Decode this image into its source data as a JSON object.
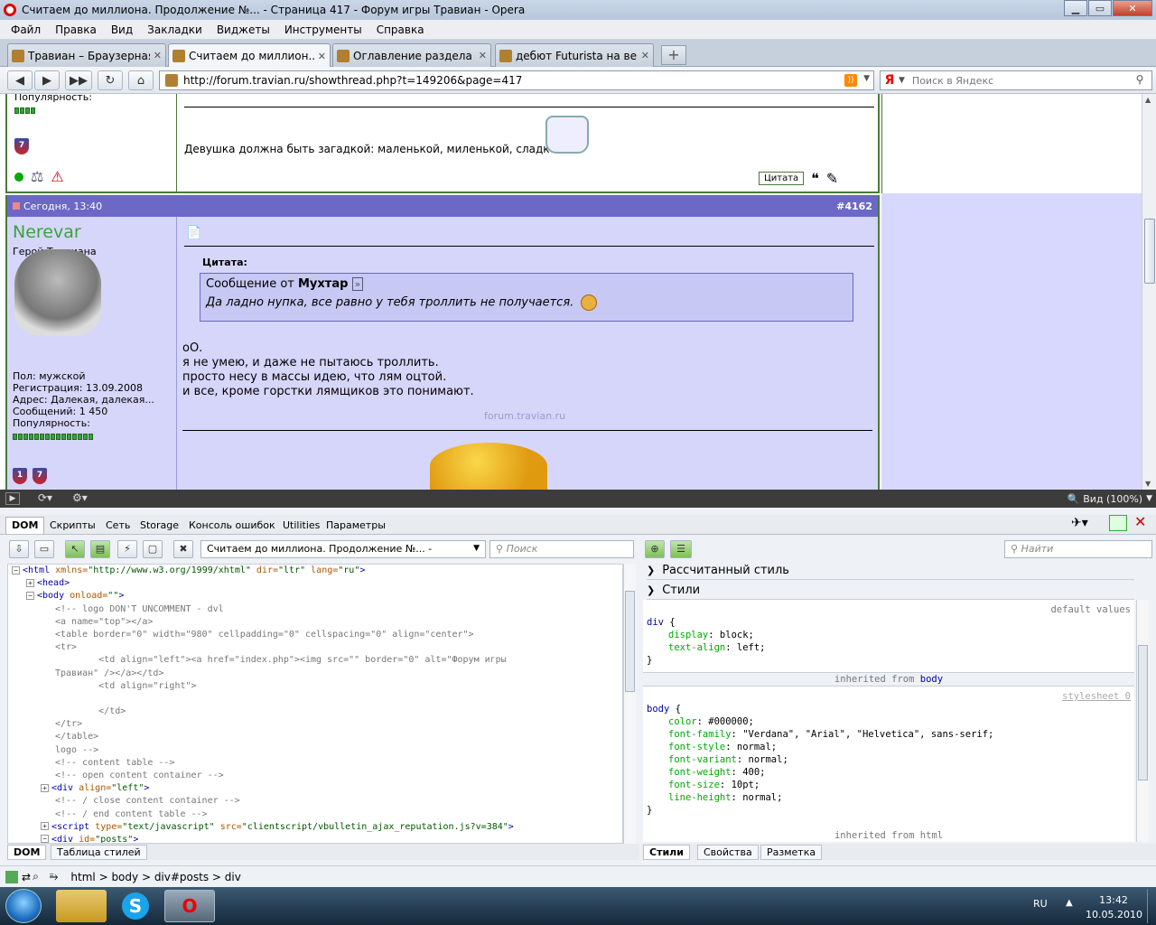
{
  "window": {
    "title": "Считаем до миллиона. Продолжение №... - Страница 417 - Форум игры Травиан - Opera",
    "btn_min": "▁",
    "btn_max": "▭",
    "btn_close": "✕"
  },
  "menu": [
    "Файл",
    "Правка",
    "Вид",
    "Закладки",
    "Виджеты",
    "Инструменты",
    "Справка"
  ],
  "tabs": [
    {
      "label": "Травиан – Браузерная...",
      "close": "✕"
    },
    {
      "label": "Считаем до миллион...",
      "close": "✕"
    },
    {
      "label": "Оглавление раздела Г...",
      "close": "✕"
    },
    {
      "label": "дебют Futurista на вер...",
      "close": "✕"
    }
  ],
  "new_tab": "+",
  "address": {
    "url": "http://forum.travian.ru/showthread.php?t=149206&page=417",
    "search_placeholder": "Поиск в Яндекс",
    "search_engine": "Я",
    "rss": "rss"
  },
  "nav": {
    "back": "◀",
    "forward": "▶",
    "fastforward": "▶▶",
    "reload": "↻",
    "home": "⌂"
  },
  "post_prev": {
    "popularity_label": "Популярность:",
    "shield": "7",
    "signature": "Девушка должна быть загадкой: маленькой, миленькой, сладкой.",
    "quote_btn": "Цитата"
  },
  "post": {
    "date": "Сегодня, 13:40",
    "number": "#4162",
    "username": "Nerevar",
    "usertitle": "Герой Травиана",
    "info": [
      "Пол: мужской",
      "Регистрация: 13.09.2008",
      "Адрес: Далекая, далекая...",
      "Сообщений: 1 450",
      "Популярность:"
    ],
    "shields": [
      "1",
      "7"
    ],
    "quote_label": "Цитата:",
    "quote_from_prefix": "Сообщение от",
    "quote_author": "Мухтар",
    "quote_text": "Да ладно нупка, все равно у тебя троллить не получается.",
    "body": [
      "оО.",
      "я не умею, и даже не пытаюсь троллить.",
      "просто несу в массы идею, что лям оцтой.",
      "и все, кроме горстки лямщиков это понимают."
    ],
    "watermark": "forum.travian.ru"
  },
  "statusbar": {
    "zoom": "Вид (100%)"
  },
  "devtools": {
    "tabs": [
      "DOM",
      "Скрипты",
      "Сеть",
      "Storage",
      "Консоль ошибок",
      "Utilities",
      "Параметры"
    ],
    "doc_select": "Считаем до миллиона. Продолжение №... -",
    "search_placeholder": "Поиск",
    "find_placeholder": "Найти",
    "bottom_tabs": [
      "DOM",
      "Таблица стилей"
    ],
    "right_bottom_tabs": [
      "Стили",
      "Свойства",
      "Разметка"
    ],
    "computed_label": "Рассчитанный стиль",
    "styles_label": "Стили",
    "default_values": "default values",
    "inherited_body": "inherited from",
    "inherited_body_el": "body",
    "stylesheet_link": "stylesheet 0",
    "inherited_html": "inherited from html",
    "breadcrumb": [
      "html",
      "body",
      "div#posts",
      "div"
    ]
  },
  "dom_lines": [
    {
      "indent": 0,
      "exp": "−",
      "html": "<span class='tag'>&lt;html</span> <span class='att'>xmlns=</span><span class='val'>\"http://www.w3.org/1999/xhtml\"</span> <span class='att'>dir=</span><span class='val'>\"ltr\"</span> <span class='att'>lang=</span><span class='val'>\"ru\"</span><span class='tag'>&gt;</span>"
    },
    {
      "indent": 1,
      "exp": "+",
      "html": "<span class='tag'>&lt;head&gt;</span>"
    },
    {
      "indent": 1,
      "exp": "−",
      "html": "<span class='tag'>&lt;body</span> <span class='att'>onload=</span><span class='val'>\"\"</span><span class='tag'>&gt;</span>"
    },
    {
      "indent": 2,
      "exp": "",
      "html": "<span class='cmt'>&lt;!-- logo DON'T UNCOMMENT - dvl</span>"
    },
    {
      "indent": 2,
      "exp": "",
      "html": "<span class='cmt'>&lt;a name=\"top\"&gt;&lt;/a&gt;</span>"
    },
    {
      "indent": 2,
      "exp": "",
      "html": "<span class='cmt'>&lt;table border=\"0\" width=\"980\" cellpadding=\"0\" cellspacing=\"0\" align=\"center\"&gt;</span>"
    },
    {
      "indent": 2,
      "exp": "",
      "html": "<span class='cmt'>&lt;tr&gt;</span>"
    },
    {
      "indent": 2,
      "exp": "",
      "html": "<span class='cmt'>&nbsp;&nbsp;&nbsp;&nbsp;&nbsp;&nbsp;&nbsp;&nbsp;&lt;td align=\"left\"&gt;&lt;a href=\"index.php\"&gt;&lt;img src=\"\" border=\"0\" alt=\"Форум игры</span>"
    },
    {
      "indent": 2,
      "exp": "",
      "html": "<span class='cmt'>Травиан\" /&gt;&lt;/a&gt;&lt;/td&gt;</span>"
    },
    {
      "indent": 2,
      "exp": "",
      "html": "<span class='cmt'>&nbsp;&nbsp;&nbsp;&nbsp;&nbsp;&nbsp;&nbsp;&nbsp;&lt;td align=\"right\"&gt;</span>"
    },
    {
      "indent": 2,
      "exp": "",
      "html": "&nbsp;"
    },
    {
      "indent": 2,
      "exp": "",
      "html": "<span class='cmt'>&nbsp;&nbsp;&nbsp;&nbsp;&nbsp;&nbsp;&nbsp;&nbsp;&lt;/td&gt;</span>"
    },
    {
      "indent": 2,
      "exp": "",
      "html": "<span class='cmt'>&lt;/tr&gt;</span>"
    },
    {
      "indent": 2,
      "exp": "",
      "html": "<span class='cmt'>&lt;/table&gt;</span>"
    },
    {
      "indent": 2,
      "exp": "",
      "html": "<span class='cmt'>logo --&gt;</span>"
    },
    {
      "indent": 2,
      "exp": "",
      "html": "<span class='cmt'>&lt;!-- content table --&gt;</span>"
    },
    {
      "indent": 2,
      "exp": "",
      "html": "<span class='cmt'>&lt;!-- open content container --&gt;</span>"
    },
    {
      "indent": 2,
      "exp": "+",
      "html": "<span class='tag'>&lt;div</span> <span class='att'>align=</span><span class='val'>\"left\"</span><span class='tag'>&gt;</span>"
    },
    {
      "indent": 2,
      "exp": "",
      "html": "<span class='cmt'>&lt;!-- / close content container --&gt;</span>"
    },
    {
      "indent": 2,
      "exp": "",
      "html": "<span class='cmt'>&lt;!-- / end content table --&gt;</span>"
    },
    {
      "indent": 2,
      "exp": "+",
      "html": "<span class='tag'>&lt;script</span> <span class='att'>type=</span><span class='val'>\"text/javascript\"</span> <span class='att'>src=</span><span class='val'>\"clientscript/vbulletin_ajax_reputation.js?v=384\"</span><span class='tag'>&gt;</span>"
    },
    {
      "indent": 2,
      "exp": "−",
      "html": "<span class='tag'>&lt;div</span> <span class='att'>id=</span><span class='val'>\"posts\"</span><span class='tag'>&gt;</span>"
    }
  ],
  "styles_div": {
    "selector": "div {",
    "props": [
      [
        "display",
        "block;"
      ],
      [
        "text-align",
        "left;"
      ]
    ],
    "close": "}"
  },
  "styles_body": {
    "selector": "body {",
    "props": [
      [
        "color",
        "#000000;"
      ],
      [
        "font-family",
        "\"Verdana\", \"Arial\", \"Helvetica\", sans-serif;"
      ],
      [
        "font-style",
        "normal;"
      ],
      [
        "font-variant",
        "normal;"
      ],
      [
        "font-weight",
        "400;"
      ],
      [
        "font-size",
        "10pt;"
      ],
      [
        "line-height",
        "normal;"
      ]
    ],
    "close": "}"
  },
  "taskbar": {
    "lang": "RU",
    "time": "13:42",
    "date": "10.05.2010"
  }
}
